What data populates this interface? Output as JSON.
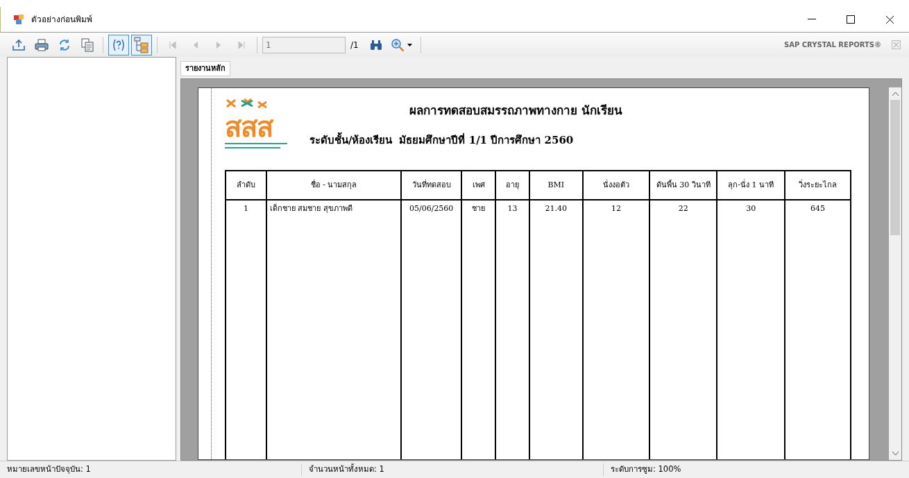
{
  "window": {
    "title": "ตัวอย่างก่อนพิมพ์"
  },
  "toolbar": {
    "buttons": [
      {
        "kind": "export",
        "disabled": false,
        "on": false
      },
      {
        "kind": "print",
        "disabled": false,
        "on": false
      },
      {
        "kind": "refresh",
        "disabled": false,
        "on": false
      },
      {
        "kind": "copy",
        "disabled": false,
        "on": false
      },
      {
        "kind": "help",
        "disabled": false,
        "on": true
      },
      {
        "kind": "tree",
        "disabled": false,
        "on": true
      },
      {
        "kind": "first",
        "disabled": true,
        "on": false
      },
      {
        "kind": "prev",
        "disabled": true,
        "on": false
      },
      {
        "kind": "next",
        "disabled": true,
        "on": false
      },
      {
        "kind": "last",
        "disabled": true,
        "on": false
      }
    ],
    "page_field": {
      "value": "1"
    },
    "page_total": "/1",
    "brand": "SAP CRYSTAL REPORTS®"
  },
  "tabs": [
    {
      "label": "รายงานหลัก",
      "selected": true
    }
  ],
  "report": {
    "logo_text": "สสส",
    "title": "ผลการทดสอบสมรรถภาพทางกาย นักเรียน",
    "level_label": "ระดับชั้น/ห้องเรียน",
    "level_value": "มัธยมศึกษาปีที่ 1/1 ปีการศึกษา 2560",
    "columns": [
      "ลำดับ",
      "ชื่อ - นามสกุล",
      "วันที่ทดสอบ",
      "เพศ",
      "อายุ",
      "BMI",
      "นั่งงอตัว",
      "ดันพื้น 30 วินาที",
      "ลุก-นั่ง 1 นาที",
      "วิ่งระยะไกล"
    ],
    "rows": [
      [
        "1",
        "เด็กชาย สมชาย สุขภาพดี",
        "05/06/2560",
        "ชาย",
        "13",
        "21.40",
        "12",
        "22",
        "30",
        "645"
      ]
    ]
  },
  "status_bar": [
    "หมายเลขหน้าปัจจุบัน: 1",
    "จำนวนหน้าทั้งหมด: 1",
    "ระดับการซูม: 100%"
  ]
}
